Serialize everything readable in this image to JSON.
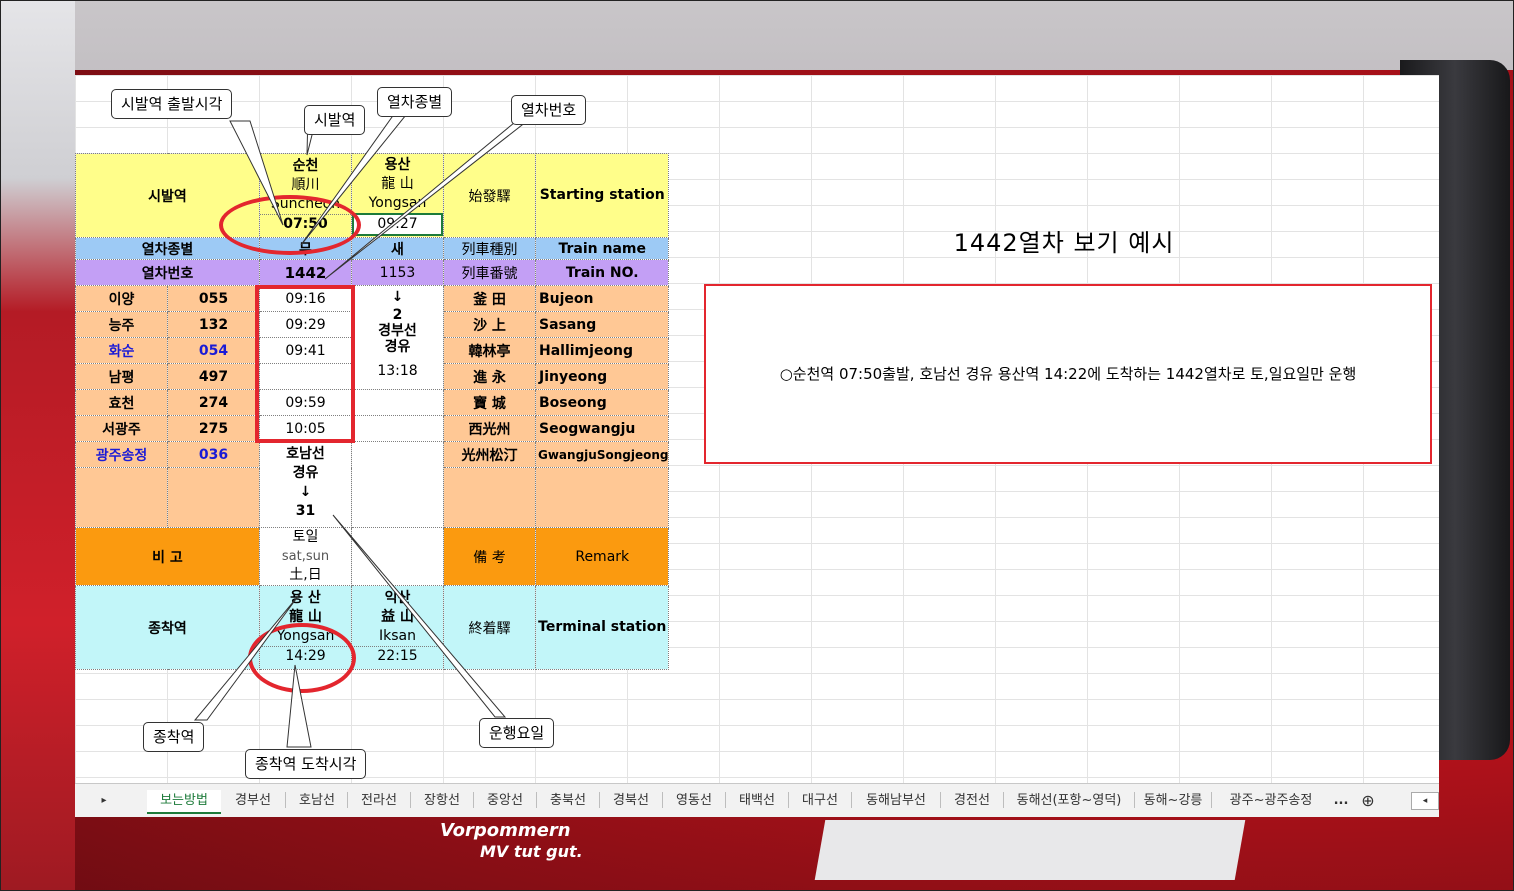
{
  "row_labels": {
    "start": "시발역",
    "type": "열차종별",
    "number": "열차번호",
    "remark": "비 고",
    "terminal": "종착역"
  },
  "row_labels_hanja": {
    "start": "始發驛",
    "type": "列車種別",
    "number": "列車番號",
    "remark": "備 考",
    "terminal": "終着驛"
  },
  "row_labels_en": {
    "start": "Starting station",
    "type": "Train name",
    "number": "Train NO.",
    "remark": "Remark",
    "terminal": "Terminal station"
  },
  "trains": [
    {
      "start_ko": "순천",
      "start_hanja": "順川",
      "start_en": "Suncheon",
      "depart": "07:50",
      "type": "무",
      "number": "1442",
      "route_note": [
        "호남선",
        "경유",
        "↓",
        "31"
      ],
      "remark": [
        "토일",
        "sat,sun",
        "土,日"
      ],
      "term_ko": "용  산",
      "term_hanja": "龍  山",
      "term_en": "Yongsan",
      "arrive": "14:29"
    },
    {
      "start_ko": "용산",
      "start_hanja": "龍  山",
      "start_en": "Yongsan",
      "depart": "09:27",
      "type": "새",
      "number": "1153",
      "route_note": [
        "↓",
        "2",
        "경부선",
        "경유"
      ],
      "route_time": "13:18",
      "term_ko": "익산",
      "term_hanja": "益  山",
      "term_en": "Iksan",
      "arrive": "22:15"
    }
  ],
  "stations": [
    {
      "name": "이양",
      "code": "055",
      "time": "09:16",
      "hanja": "釜  田",
      "en": "Bujeon",
      "blue": false
    },
    {
      "name": "능주",
      "code": "132",
      "time": "09:29",
      "hanja": "沙  上",
      "en": "Sasang",
      "blue": false
    },
    {
      "name": "화순",
      "code": "054",
      "time": "09:41",
      "hanja": "韓林亭",
      "en": "Hallimjeong",
      "blue": true
    },
    {
      "name": "남평",
      "code": "497",
      "time": "",
      "hanja": "進  永",
      "en": "Jinyeong",
      "blue": false
    },
    {
      "name": "효천",
      "code": "274",
      "time": "09:59",
      "hanja": "寶  城",
      "en": "Boseong",
      "blue": false
    },
    {
      "name": "서광주",
      "code": "275",
      "time": "10:05",
      "hanja": "西光州",
      "en": "Seogwangju",
      "blue": false
    },
    {
      "name": "광주송정",
      "code": "036",
      "time": "",
      "hanja": "光州松汀",
      "en": "GwangjuSongjeong",
      "blue": true
    }
  ],
  "callouts": {
    "depart_time": "시발역 출발시각",
    "start_station": "시발역",
    "train_type": "열차종별",
    "train_number": "열차번호",
    "terminal": "종착역",
    "arrive_time": "종착역 도착시각",
    "run_days": "운행요일"
  },
  "example": {
    "title": "1442열차 보기 예시",
    "description": "○순천역 07:50출발, 호남선 경유 용산역 14:22에 도착하는 1442열차로 토,일요일만 운행"
  },
  "tabs": [
    "보는방법",
    "경부선",
    "호남선",
    "전라선",
    "장항선",
    "중앙선",
    "충북선",
    "경북선",
    "영동선",
    "태백선",
    "대구선",
    "동해남부선",
    "경전선",
    "동해선(포항~영덕)",
    "동해~강릉",
    "광주~광주송정"
  ],
  "tab_more": "...",
  "tab_add": "⊕",
  "background_logo": [
    "Vorpommern",
    "MV tut gut."
  ],
  "colors": {
    "yellow": "#fffe8a",
    "blue": "#9dcaf5",
    "purple": "#c39ff5",
    "orange": "#ffc895",
    "dark_orange": "#fb9a0f",
    "cyan": "#c2f6f9",
    "annotation_red": "#e3262e",
    "active_tab_green": "#1d7b3a"
  }
}
